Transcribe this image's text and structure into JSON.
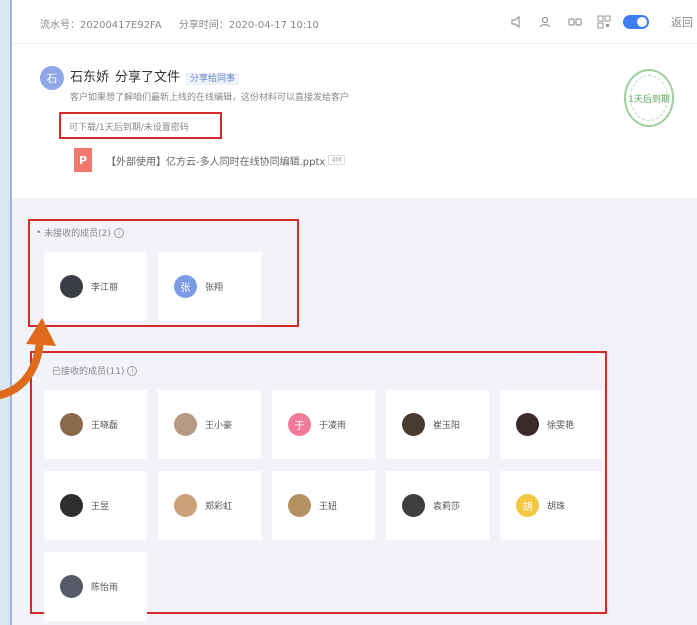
{
  "header": {
    "serial_label": "流水号：20200417E92FA",
    "share_time_label": "分享时间：2020-04-17 10:10",
    "back_label": "返回"
  },
  "share": {
    "avatar_char": "石",
    "sender": "石东娇",
    "action": "分享了文件",
    "tag": "分享给同事",
    "note": "客户如果想了解咱们最新上线的在线编辑，这份材料可以直接发给客户",
    "access": "可下载/1天后到期/未设置密码",
    "file_icon": "P",
    "file_name": "【外部使用】亿方云-多人同时在线协同编辑.pptx",
    "file_size": "4M",
    "stamp_text": "1天后到期"
  },
  "unreceived": {
    "label": "未接收的成员(2)",
    "info": "i",
    "members": [
      {
        "name": "李江丽",
        "avatar": "",
        "color": "#3a3e44"
      },
      {
        "name": "张翔",
        "avatar": "张",
        "color": "#7b9be6"
      }
    ]
  },
  "received": {
    "label": "已接收的成员(11)",
    "info": "i",
    "members": [
      {
        "name": "王晓磊",
        "avatar": "",
        "color": "#8a6a4a"
      },
      {
        "name": "王小豪",
        "avatar": "",
        "color": "#b79a86"
      },
      {
        "name": "于凌雨",
        "avatar": "于",
        "color": "#f07a9a"
      },
      {
        "name": "崔玉阳",
        "avatar": "",
        "color": "#4a3a30"
      },
      {
        "name": "徐雯艳",
        "avatar": "",
        "color": "#3a2a2a"
      },
      {
        "name": "王昱",
        "avatar": "",
        "color": "#2e2e2e"
      },
      {
        "name": "郑彩虹",
        "avatar": "",
        "color": "#c9a27a"
      },
      {
        "name": "王妞",
        "avatar": "",
        "color": "#b59060"
      },
      {
        "name": "袁莉莎",
        "avatar": "",
        "color": "#3e3e3e"
      },
      {
        "name": "胡珠",
        "avatar": "胡",
        "color": "#f5c842"
      },
      {
        "name": "陈怡雨",
        "avatar": "",
        "color": "#555a66"
      }
    ]
  },
  "colors": {
    "highlight": "#d32a2a",
    "arrow": "#e06a1c",
    "accent": "#3d7ff0"
  }
}
